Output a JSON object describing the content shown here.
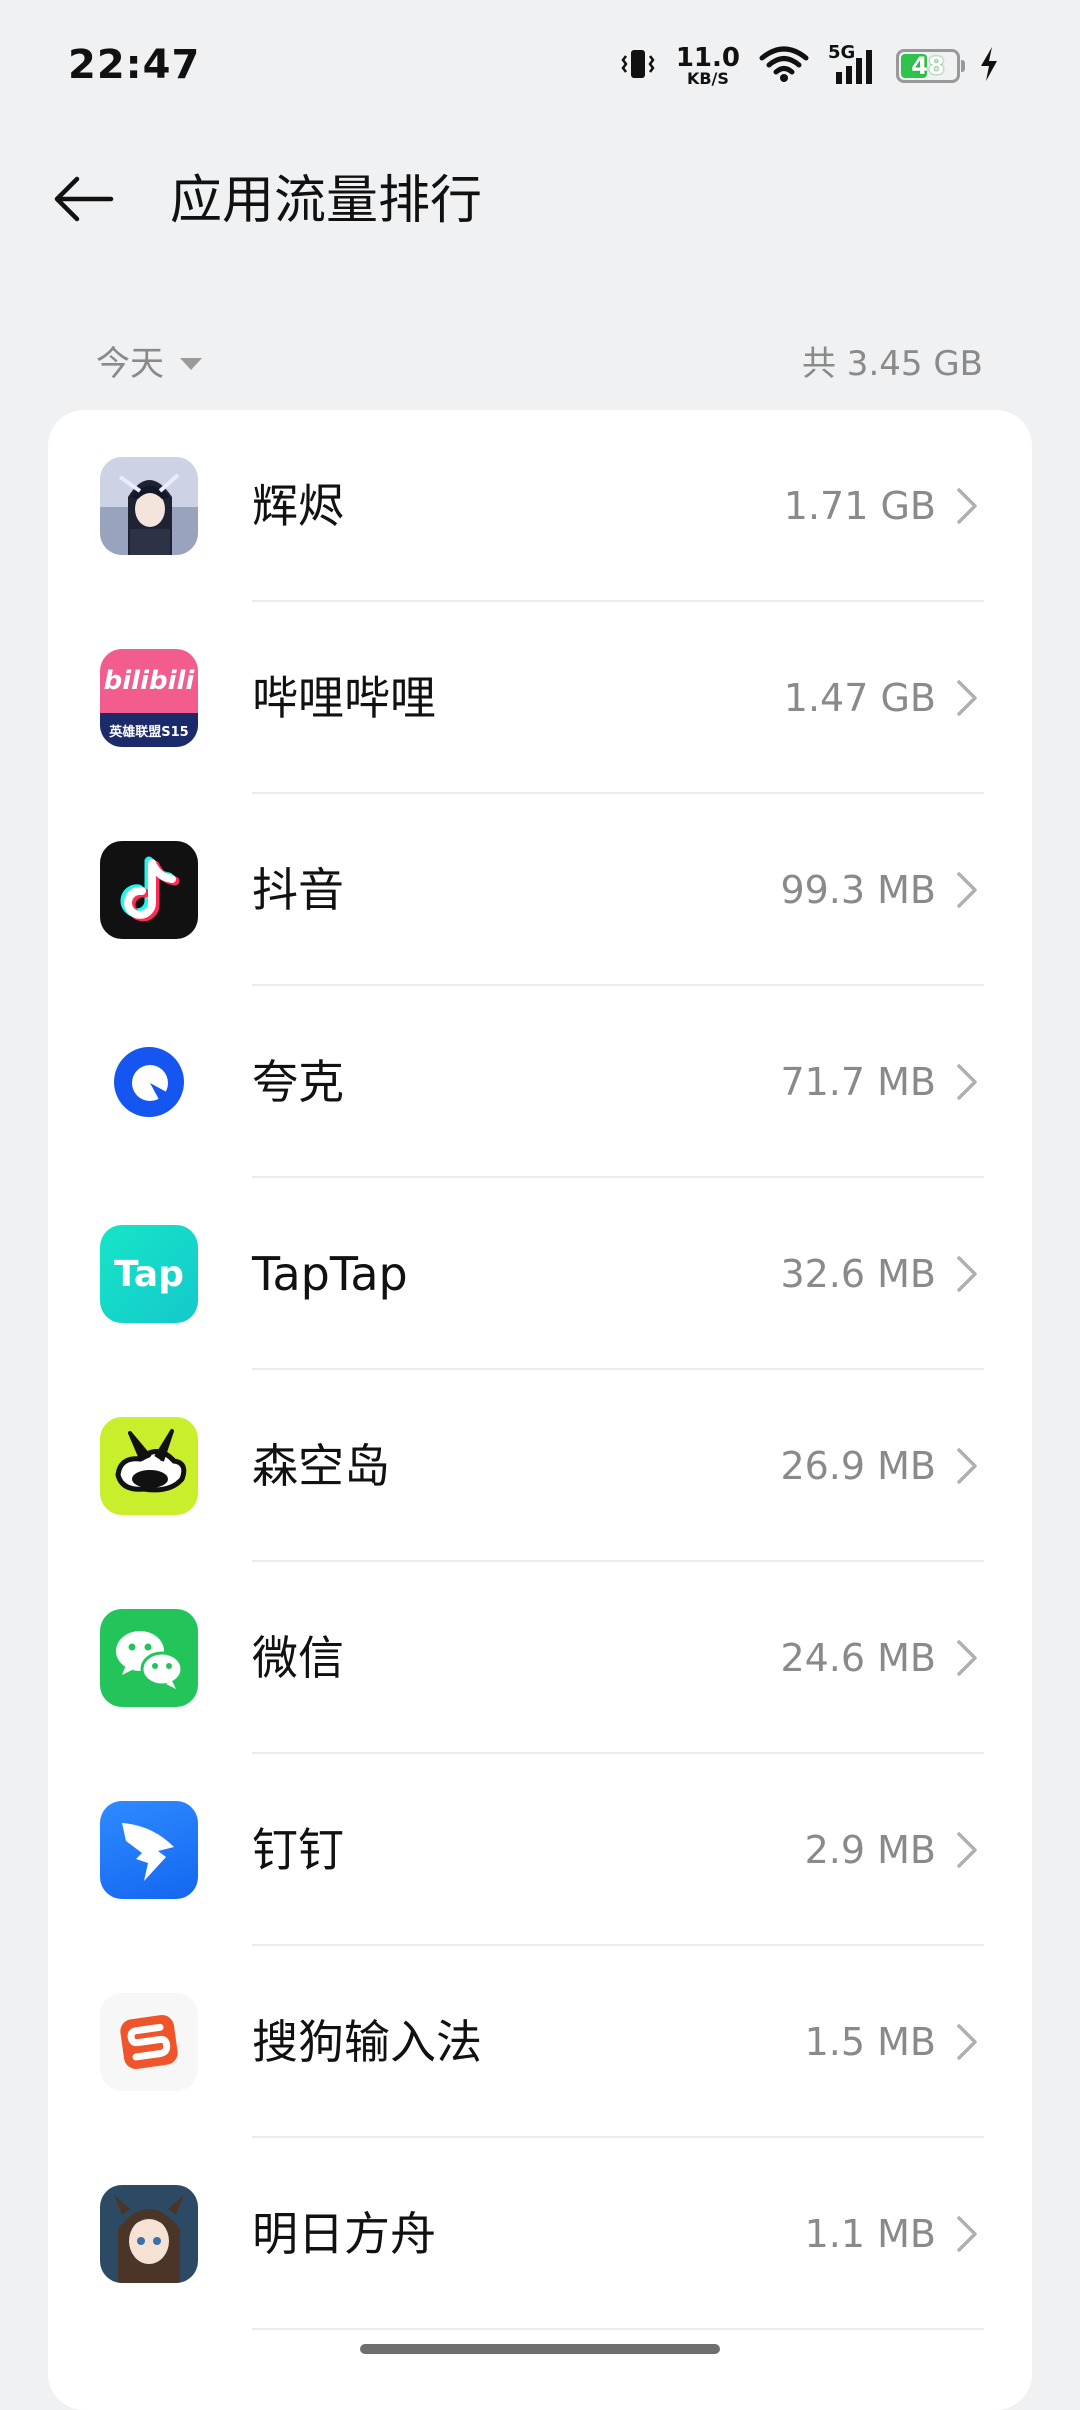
{
  "status_bar": {
    "time": "22:47",
    "net_speed_value": "11.0",
    "net_speed_unit": "KB/S",
    "network_type": "5G",
    "battery_level": "48",
    "icons": [
      "vibrate-icon",
      "wifi-icon",
      "signal-icon",
      "battery-icon",
      "charging-icon"
    ]
  },
  "header": {
    "title": "应用流量排行"
  },
  "summary": {
    "period": "今天",
    "total": "共 3.45 GB"
  },
  "apps": [
    {
      "name": "辉烬",
      "size": "1.71 GB"
    },
    {
      "name": "哔哩哔哩",
      "size": "1.47 GB"
    },
    {
      "name": "抖音",
      "size": "99.3 MB"
    },
    {
      "name": "夸克",
      "size": "71.7 MB"
    },
    {
      "name": "TapTap",
      "size": "32.6 MB"
    },
    {
      "name": "森空岛",
      "size": "26.9 MB"
    },
    {
      "name": "微信",
      "size": "24.6 MB"
    },
    {
      "name": "钉钉",
      "size": "2.9 MB"
    },
    {
      "name": "搜狗输入法",
      "size": "1.5 MB"
    },
    {
      "name": "明日方舟",
      "size": "1.1 MB"
    }
  ],
  "icon_labels": {
    "bilibili_top": "bilibili",
    "bilibili_bottom": "英雄联盟S15",
    "taptap": "Tap"
  },
  "colors": {
    "background": "#f0f1f3",
    "card": "#ffffff",
    "secondary_text": "#8a8a8a",
    "battery_fill": "#2fc34b"
  }
}
